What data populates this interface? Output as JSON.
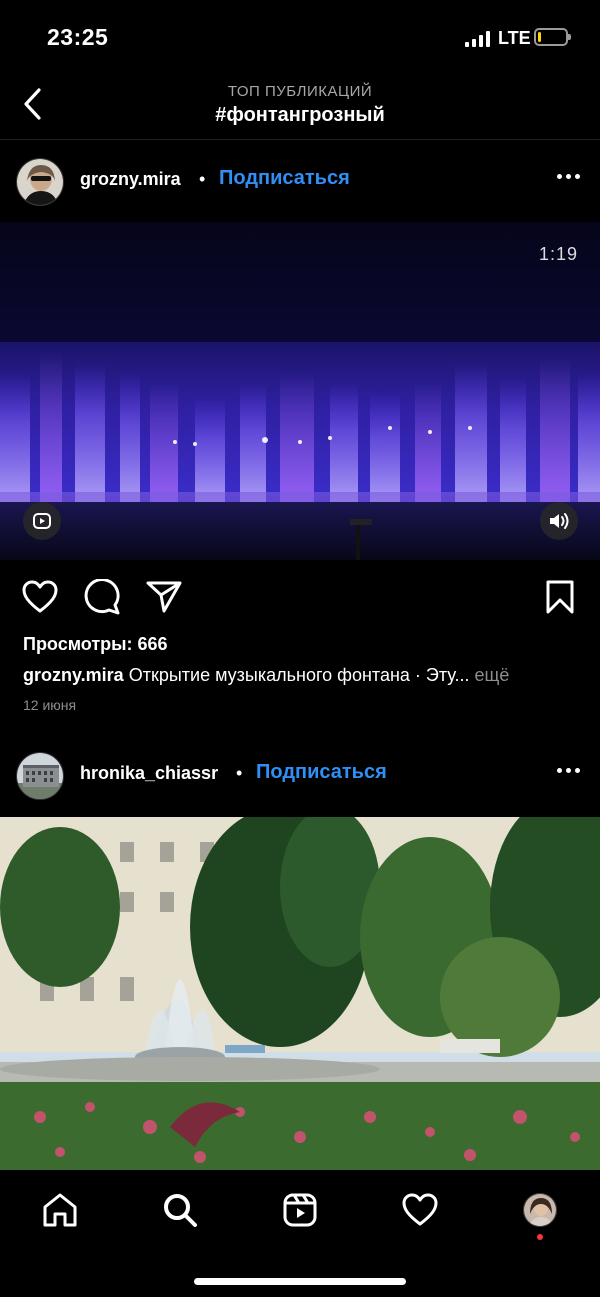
{
  "status_bar": {
    "time": "23:25",
    "network": "LTE",
    "battery_level": 0.12
  },
  "header": {
    "subtitle": "ТОП ПУБЛИКАЦИЙ",
    "title": "#фонтангрозный",
    "back_icon": "chevron-left-icon"
  },
  "posts": [
    {
      "username": "grozny.mira",
      "separator": "•",
      "follow_label": "Подписаться",
      "video_duration": "1:19",
      "views": "Просмотры: 666",
      "caption_user": "grozny.mira",
      "caption_text": "Открытие музыкального фонтана · Эту...",
      "caption_more": "ещё",
      "date": "12 июня"
    },
    {
      "username": "hronika_chiassr",
      "separator": "•",
      "follow_label": "Подписаться"
    }
  ],
  "tabbar": {
    "items": [
      "home-icon",
      "search-icon",
      "reels-icon",
      "heart-icon",
      "profile-avatar"
    ]
  },
  "colors": {
    "accent": "#2f8ff5",
    "background": "#000000",
    "notification": "#ff3040"
  }
}
